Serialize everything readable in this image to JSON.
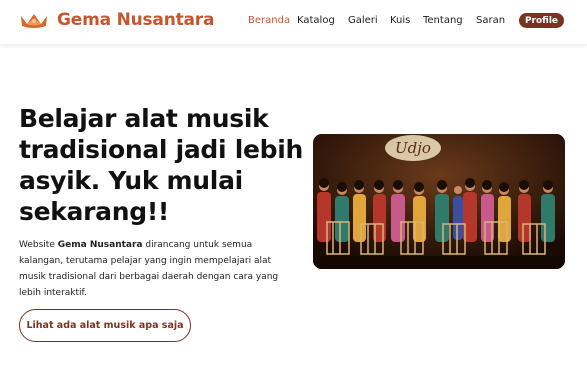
{
  "brand": {
    "name": "Gema Nusantara",
    "logo_icon": "gong-flame-icon",
    "color": "#c8552c"
  },
  "nav": {
    "items": [
      {
        "label": "Beranda",
        "active": true
      },
      {
        "label": "Katalog",
        "active": false
      },
      {
        "label": "Galeri",
        "active": false
      },
      {
        "label": "Kuis",
        "active": false
      },
      {
        "label": "Tentang",
        "active": false
      },
      {
        "label": "Saran",
        "active": false
      }
    ],
    "profile_label": "Profile",
    "active_color": "#c8552c",
    "button_color": "#7a3322"
  },
  "hero": {
    "title_lines": [
      "Belajar alat musik",
      "tradisional jadi lebih",
      "asyik. Yuk mulai",
      "sekarang!!"
    ],
    "desc_prefix": "Website ",
    "desc_brand": "Gema Nusantara",
    "desc_line1_suffix": " dirancang untuk semua",
    "desc_line2": "kalangan, terutama pelajar yang ingin mempelajari alat",
    "desc_line3": "musik tradisional dari berbagai daerah dengan cara yang",
    "desc_line4": "lebih interaktif.",
    "cta_label": "Lihat ada alat musik apa saja",
    "image_banner_text": "Udjo"
  }
}
